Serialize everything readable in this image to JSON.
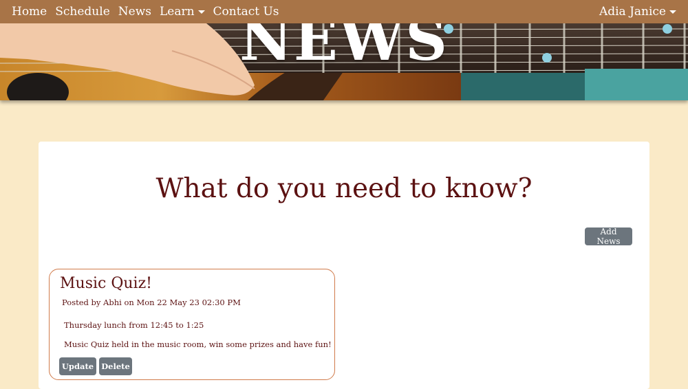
{
  "nav": {
    "items": [
      {
        "label": "Home"
      },
      {
        "label": "Schedule"
      },
      {
        "label": "News"
      },
      {
        "label": "Learn",
        "dropdown": true
      },
      {
        "label": "Contact Us"
      }
    ],
    "user": "Adia Janice"
  },
  "banner": {
    "title": "NEWS"
  },
  "main": {
    "heading": "What do you need to know?",
    "add_button": "Add News"
  },
  "news": [
    {
      "title": "Music Quiz!",
      "posted_by": "Posted by Abhi on Mon 22 May 23 02:30 PM",
      "line1": "Thursday lunch from 12:45 to 1:25",
      "line2": "Music Quiz held in the music room, win some prizes and have fun!",
      "update_label": "Update",
      "delete_label": "Delete"
    }
  ],
  "colors": {
    "navbar": "#a87447",
    "page_background": "#faeac7",
    "heading": "#5c1212",
    "button": "#6c757d",
    "card_border": "#d07a4a"
  }
}
